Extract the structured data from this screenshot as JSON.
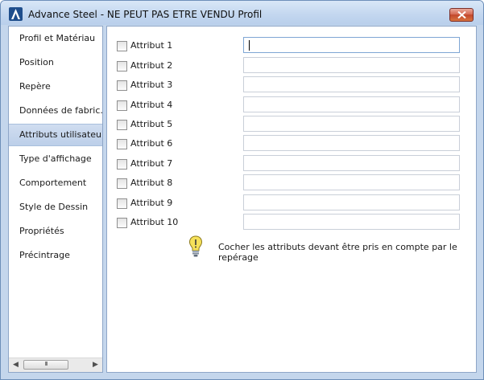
{
  "window": {
    "title": "Advance Steel - NE PEUT PAS ETRE VENDU  Profil"
  },
  "sidebar": {
    "items": [
      {
        "label": "Profil et Matériau"
      },
      {
        "label": "Position"
      },
      {
        "label": "Repère"
      },
      {
        "label": "Données de fabric..."
      },
      {
        "label": "Attributs utilisateur",
        "selected": true
      },
      {
        "label": "Type d'affichage"
      },
      {
        "label": "Comportement"
      },
      {
        "label": "Style de Dessin"
      },
      {
        "label": "Propriétés"
      },
      {
        "label": "Précintrage"
      }
    ],
    "scroll_thumb_grip": "III"
  },
  "attributes": [
    {
      "label": "Attribut 1",
      "checked": false,
      "value": "",
      "focused": true
    },
    {
      "label": "Attribut 2",
      "checked": false,
      "value": ""
    },
    {
      "label": "Attribut 3",
      "checked": false,
      "value": ""
    },
    {
      "label": "Attribut 4",
      "checked": false,
      "value": ""
    },
    {
      "label": "Attribut 5",
      "checked": false,
      "value": ""
    },
    {
      "label": "Attribut 6",
      "checked": false,
      "value": ""
    },
    {
      "label": "Attribut 7",
      "checked": false,
      "value": ""
    },
    {
      "label": "Attribut 8",
      "checked": false,
      "value": ""
    },
    {
      "label": "Attribut 9",
      "checked": false,
      "value": ""
    },
    {
      "label": "Attribut 10",
      "checked": false,
      "value": ""
    }
  ],
  "hint": {
    "icon": "lightbulb-icon",
    "text": "Cocher les attributs devant être pris en compte par le repérage"
  },
  "colors": {
    "window_frame": "#c4d6ec",
    "selected_item": "#bccfe9",
    "close_button": "#c2472c"
  }
}
